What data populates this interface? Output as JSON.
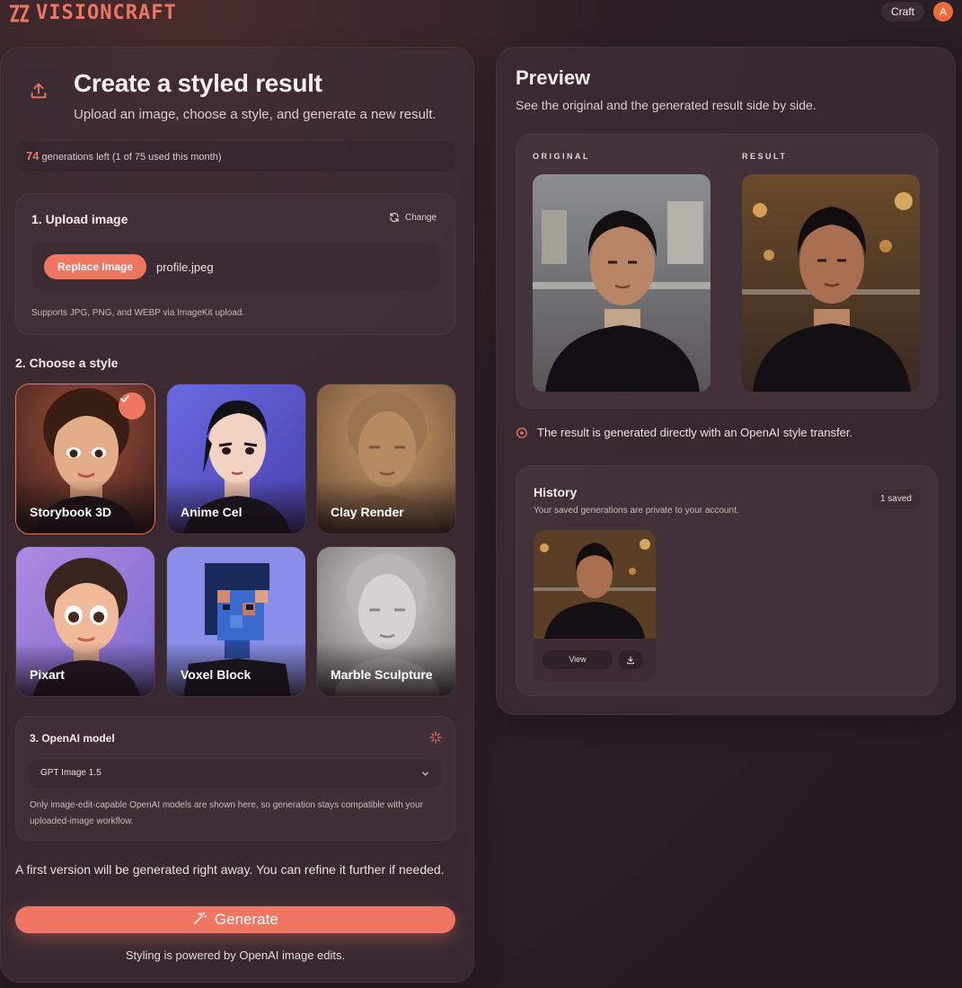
{
  "app": {
    "name": "VISIONCRAFT",
    "nav_label": "Craft",
    "avatar_initial": "A",
    "accent": "#f07664"
  },
  "create": {
    "title": "Create a styled result",
    "subtitle": "Upload an image, choose a style, and generate a new result.",
    "quota_count": "74",
    "quota_text": "generations left",
    "quota_detail": "(1 of 75 used this month)"
  },
  "upload": {
    "title": "1. Upload image",
    "change_label": "Change",
    "replace_label": "Replace Image",
    "filename": "profile.jpeg",
    "supports": "Supports JPG, PNG, and WEBP via ImageKit upload."
  },
  "styles": {
    "title": "2. Choose a style",
    "selected": "Storybook 3D",
    "items": [
      {
        "label": "Storybook 3D"
      },
      {
        "label": "Anime Cel"
      },
      {
        "label": "Clay Render"
      },
      {
        "label": "Pixart"
      },
      {
        "label": "Voxel Block"
      },
      {
        "label": "Marble Sculpture"
      }
    ]
  },
  "model": {
    "title": "3. OpenAI model",
    "selected": "GPT Image 1.5",
    "note": "Only image-edit-capable OpenAI models are shown here, so generation stays compatible with your uploaded-image workflow."
  },
  "generate": {
    "info": "A first version will be generated right away. You can refine it further if needed.",
    "button_label": "Generate",
    "footer": "Styling is powered by OpenAI image edits."
  },
  "preview": {
    "title": "Preview",
    "subtitle": "See the original and the generated result side by side.",
    "original_label": "ORIGINAL",
    "result_label": "RESULT",
    "notice": "The result is generated directly with an OpenAI style transfer."
  },
  "history": {
    "title": "History",
    "subtitle": "Your saved generations are private to your account.",
    "count_label": "1 saved",
    "view_label": "View"
  }
}
